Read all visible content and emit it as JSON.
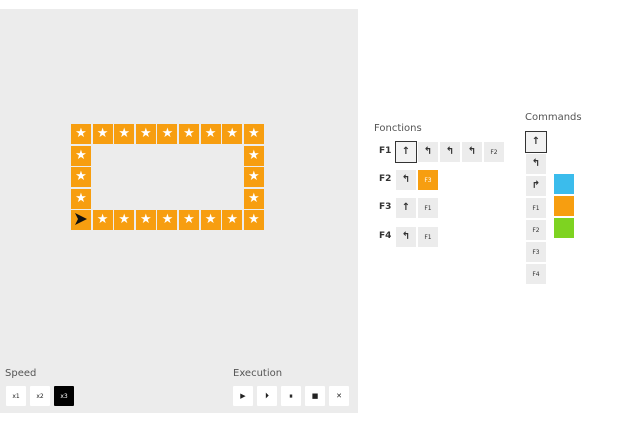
{
  "speed": {
    "label": "Speed",
    "options": [
      "x1",
      "x2",
      "x3"
    ],
    "selected": "x3"
  },
  "execution": {
    "label": "Execution",
    "buttons": [
      {
        "icon": "play-icon",
        "glyph": "▶"
      },
      {
        "icon": "step-icon",
        "glyph": "⏵"
      },
      {
        "icon": "pause-icon",
        "glyph": "⏸"
      },
      {
        "icon": "stop-icon",
        "glyph": "■"
      },
      {
        "icon": "clear-icon",
        "glyph": "✕"
      }
    ]
  },
  "board": {
    "star_glyph": "★",
    "tile_color": "#f79e10",
    "robot_direction": "east"
  },
  "functions": {
    "label": "Fonctions",
    "rows": [
      {
        "name": "F1",
        "slots": [
          {
            "kind": "forward",
            "glyph": "↑",
            "selected": true
          },
          {
            "kind": "left",
            "glyph": "↰"
          },
          {
            "kind": "left",
            "glyph": "↰"
          },
          {
            "kind": "left",
            "glyph": "↰"
          },
          {
            "kind": "call",
            "text": "F2"
          }
        ]
      },
      {
        "name": "F2",
        "slots": [
          {
            "kind": "left",
            "glyph": "↰"
          },
          {
            "kind": "call",
            "text": "F3",
            "color": "orange"
          }
        ]
      },
      {
        "name": "F3",
        "slots": [
          {
            "kind": "forward",
            "glyph": "↑"
          },
          {
            "kind": "call",
            "text": "F1"
          }
        ]
      },
      {
        "name": "F4",
        "slots": [
          {
            "kind": "left",
            "glyph": "↰"
          },
          {
            "kind": "call",
            "text": "F1"
          }
        ]
      }
    ]
  },
  "commands": {
    "label": "Commands",
    "items": [
      {
        "kind": "forward",
        "glyph": "↑",
        "selected": true
      },
      {
        "kind": "left",
        "glyph": "↰"
      },
      {
        "kind": "right",
        "glyph": "↱"
      },
      {
        "kind": "call",
        "text": "F1"
      },
      {
        "kind": "call",
        "text": "F2"
      },
      {
        "kind": "call",
        "text": "F3"
      },
      {
        "kind": "call",
        "text": "F4"
      }
    ],
    "colors": [
      "#3bbcec",
      "#f79e10",
      "#7ed321"
    ]
  }
}
